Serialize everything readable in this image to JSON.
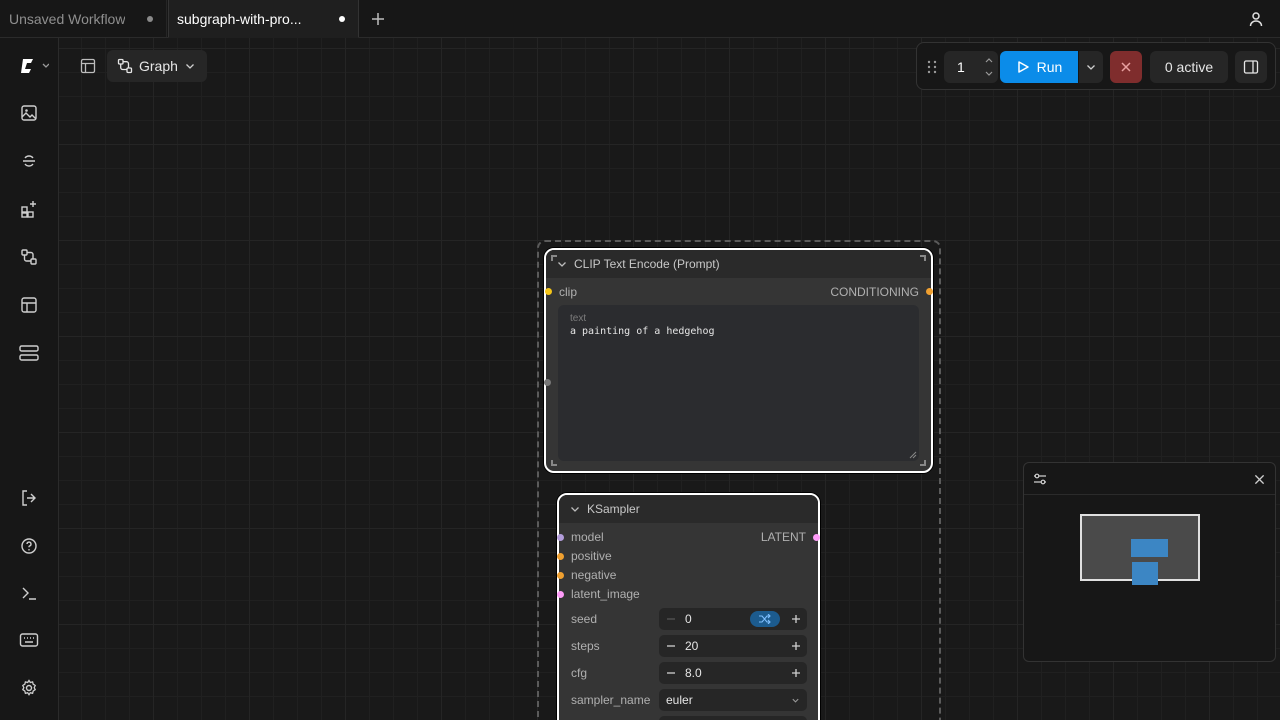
{
  "tabs": [
    {
      "label": "Unsaved Workflow",
      "modified": true,
      "active": false
    },
    {
      "label": "subgraph-with-pro...",
      "modified": true,
      "active": true
    }
  ],
  "toolbar": {
    "view_mode_label": "Graph",
    "batch_count": "1",
    "run_label": "Run",
    "queue_status": "0 active"
  },
  "sidebar": {
    "items": [
      {
        "icon": "comfy-logo-icon"
      },
      {
        "icon": "images-icon"
      },
      {
        "icon": "models-icon"
      },
      {
        "icon": "node-library-icon"
      },
      {
        "icon": "workflows-icon"
      },
      {
        "icon": "templates-icon"
      },
      {
        "icon": "queue-icon"
      },
      {
        "icon": "logout-icon"
      },
      {
        "icon": "help-icon"
      },
      {
        "icon": "terminal-icon"
      },
      {
        "icon": "keyboard-icon"
      },
      {
        "icon": "settings-icon"
      }
    ]
  },
  "clip_node": {
    "title": "CLIP Text Encode (Prompt)",
    "input": "clip",
    "output": "CONDITIONING",
    "text_label": "text",
    "text_value": "a painting of a hedgehog"
  },
  "ksampler_node": {
    "title": "KSampler",
    "inputs": [
      "model",
      "positive",
      "negative",
      "latent_image"
    ],
    "output": "LATENT",
    "widgets": {
      "seed": {
        "label": "seed",
        "value": "0"
      },
      "steps": {
        "label": "steps",
        "value": "20"
      },
      "cfg": {
        "label": "cfg",
        "value": "8.0"
      },
      "sampler_name": {
        "label": "sampler_name",
        "value": "euler"
      }
    }
  },
  "colors": {
    "accent": "#0b8ce9",
    "cancel": "#7f2d2d",
    "clip_socket": "#f5c518",
    "conditioning_socket": "#f0a030",
    "model_socket": "#b39ddb",
    "latent_socket": "#ff9cf9"
  }
}
